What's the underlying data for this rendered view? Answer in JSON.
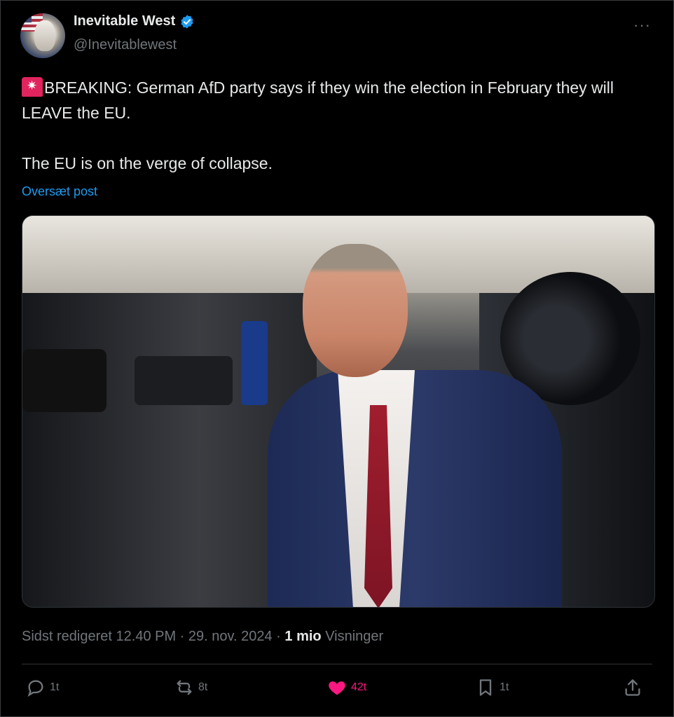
{
  "author": {
    "display_name": "Inevitable West",
    "handle": "@Inevitablewest",
    "verified": true
  },
  "post": {
    "line1": "BREAKING: German AfD party says if they win the election in February they will LEAVE the EU.",
    "line2": "The EU is on the verge of collapse.",
    "translate_link": "Oversæt post"
  },
  "meta": {
    "edited": "Sidst redigeret 12.40 PM · 29. nov. 2024 · ",
    "views_count": "1 mio",
    "views_label": " Visninger"
  },
  "actions": {
    "replies": "1t",
    "reposts": "8t",
    "likes": "42t",
    "bookmarks": "1t"
  },
  "colors": {
    "like_active": "#f91880",
    "link": "#1d9bf0",
    "muted": "#71767b"
  }
}
